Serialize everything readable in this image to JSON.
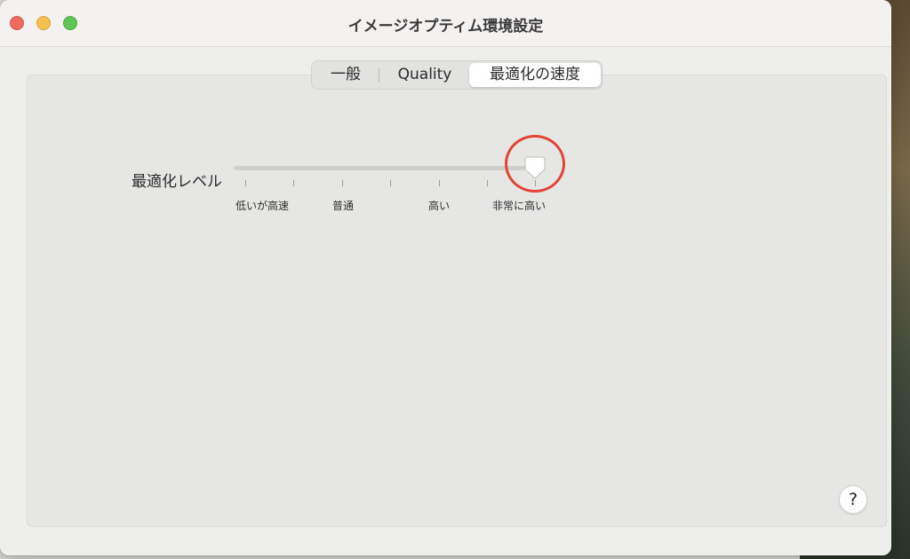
{
  "window": {
    "title": "イメージオプティム環境設定"
  },
  "tabs": [
    {
      "label": "一般",
      "selected": false
    },
    {
      "label": "Quality",
      "selected": false
    },
    {
      "label": "最適化の速度",
      "selected": true
    }
  ],
  "optimization": {
    "label": "最適化レベル",
    "tick_labels": [
      "低いが高速",
      "普通",
      "高い",
      "非常に高い"
    ],
    "tick_count": 7,
    "selected_index": 6,
    "highlight_color": "#e24434"
  },
  "help": {
    "label": "?"
  }
}
